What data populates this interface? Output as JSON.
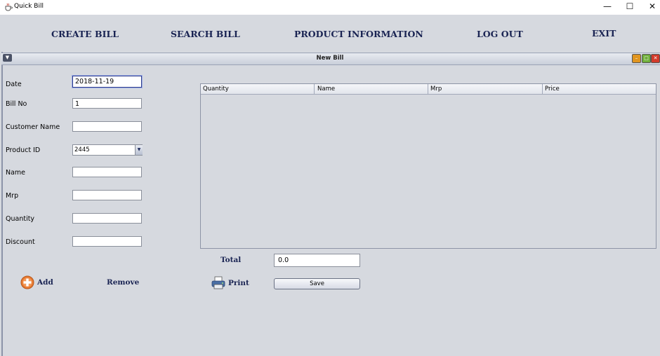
{
  "window": {
    "title": "Quick Bill",
    "controls": {
      "minimize": "—",
      "maximize": "☐",
      "close": "✕"
    }
  },
  "menu": {
    "items": [
      "CREATE BILL",
      "SEARCH BILL",
      "PRODUCT INFORMATION",
      "LOG OUT",
      "EXIT"
    ]
  },
  "frame": {
    "title": "New Bill"
  },
  "form": {
    "labels": {
      "date": "Date",
      "bill_no": "Bill No",
      "customer_name": "Customer Name",
      "product_id": "Product ID",
      "name": "Name",
      "mrp": "Mrp",
      "quantity": "Quantity",
      "discount": "Discount"
    },
    "values": {
      "date": "2018-11-19",
      "bill_no": "1",
      "customer_name": "",
      "product_id": "2445",
      "name": "",
      "mrp": "",
      "quantity": "",
      "discount": ""
    }
  },
  "table": {
    "columns": [
      "Quantity",
      "Name",
      "Mrp",
      "Price"
    ],
    "rows": []
  },
  "total": {
    "label": "Total",
    "value": "0.0"
  },
  "actions": {
    "add": "Add",
    "remove": "Remove",
    "print": "Print",
    "save": "Save"
  },
  "icons": {
    "app": "java-cup-icon",
    "add": "plus-circle-icon",
    "print": "printer-icon"
  },
  "colors": {
    "background": "#d6d9df",
    "menu_text": "#1a2453",
    "add_icon": "#e87a32"
  }
}
